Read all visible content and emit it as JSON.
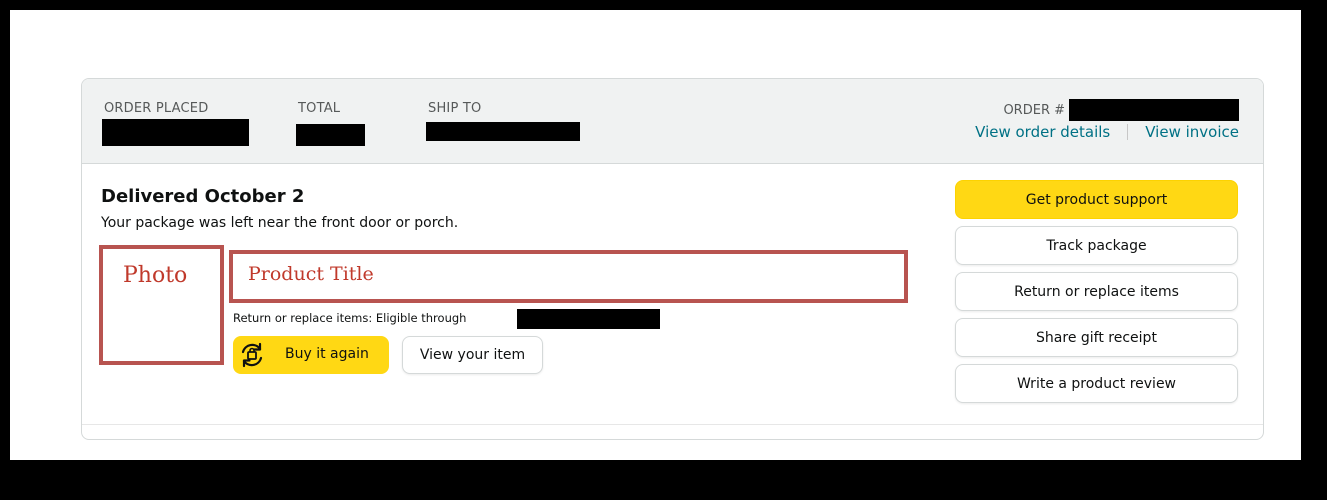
{
  "header": {
    "order_placed_label": "ORDER PLACED",
    "total_label": "TOTAL",
    "ship_to_label": "SHIP TO",
    "order_number_label": "ORDER #",
    "view_order_details": "View order details",
    "view_invoice": "View invoice"
  },
  "shipment": {
    "status_title": "Delivered October 2",
    "status_subtitle": "Your package was left near the front door or porch."
  },
  "item": {
    "photo_placeholder": "Photo",
    "title_placeholder": "Product Title",
    "return_eligibility": "Return or replace items: Eligible through",
    "buy_again_label": "Buy it again",
    "view_item_label": "View your item"
  },
  "actions": [
    {
      "label": "Get product support",
      "style": "primary"
    },
    {
      "label": "Track package",
      "style": "secondary"
    },
    {
      "label": "Return or replace items",
      "style": "secondary"
    },
    {
      "label": "Share gift receipt",
      "style": "secondary"
    },
    {
      "label": "Write a product review",
      "style": "secondary"
    }
  ],
  "colors": {
    "accent_yellow": "#ffd814",
    "link_teal": "#007185",
    "annotation_red": "#b85450",
    "header_bg": "#f0f2f2",
    "redaction": "#000000"
  },
  "icons": {
    "buy_again": "reorder-cycle-icon"
  }
}
